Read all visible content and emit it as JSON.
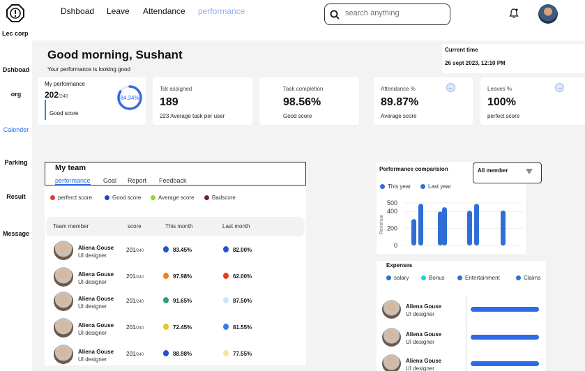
{
  "brand": "Lec corp",
  "sidebar": {
    "items": [
      {
        "label": "Dshboad",
        "active": false
      },
      {
        "label": "org",
        "active": false
      },
      {
        "label": "Calender",
        "active": true
      },
      {
        "label": "Parking",
        "active": false
      },
      {
        "label": "Result",
        "active": false
      },
      {
        "label": "Message",
        "active": false
      }
    ]
  },
  "nav": {
    "items": [
      {
        "label": "Dshboad",
        "active": false
      },
      {
        "label": "Leave",
        "active": false
      },
      {
        "label": "Attendance",
        "active": false
      },
      {
        "label": "performance",
        "active": true
      }
    ]
  },
  "search": {
    "placeholder": "search anything"
  },
  "greeting": {
    "title": "Good morning, Sushant",
    "subtitle": "Your performance is looking good"
  },
  "current_time": {
    "label": "Current time",
    "value": "26 sept 2023, 12:10 PM"
  },
  "my_performance": {
    "label": "My performance",
    "value": "202",
    "total": "/240",
    "sub": "Good score",
    "percent": "84.34%",
    "percent_value": 84.34
  },
  "cards": [
    {
      "label": "Tsk assigned",
      "value": "189",
      "sub": "223 Average task per user",
      "arrow": ""
    },
    {
      "label": "Task completion",
      "value": "98.56%",
      "sub": "Good score",
      "arrow": ""
    },
    {
      "label": "Attendance %",
      "value": "89.87%",
      "sub": "Average score",
      "arrow": "left-arrow-icon"
    },
    {
      "label": "Leaves %",
      "value": "100%",
      "sub": "perfect score",
      "arrow": "right-arrow-icon"
    }
  ],
  "team": {
    "title": "My team",
    "tabs": [
      {
        "label": "performance",
        "active": true
      },
      {
        "label": "Goal",
        "active": false
      },
      {
        "label": "Report",
        "active": false
      },
      {
        "label": "Feedback",
        "active": false
      }
    ],
    "legend": [
      {
        "label": "perferct score",
        "color": "#e53935"
      },
      {
        "label": "Good score",
        "color": "#1e3fd6"
      },
      {
        "label": "Average score",
        "color": "#8bd62b"
      },
      {
        "label": "Badscore",
        "color": "#7a2020"
      }
    ],
    "columns": [
      "Team member",
      "score",
      "This month",
      "Last month"
    ],
    "rows": [
      {
        "name": "Aliena Gouse",
        "role": "UI designer",
        "score": "201",
        "total": "/240",
        "this_month": "83.45%",
        "this_color": "#2354c9",
        "last_month": "82.00%",
        "last_color": "#2354c9"
      },
      {
        "name": "Aliena Gouse",
        "role": "UI designer",
        "score": "201",
        "total": "/240",
        "this_month": "97.98%",
        "this_color": "#ef7d22",
        "last_month": "62.00%",
        "last_color": "#e53b1f"
      },
      {
        "name": "Aliena Gouse",
        "role": "UI designer",
        "score": "201",
        "total": "/240",
        "this_month": "91.65%",
        "this_color": "#2f9e73",
        "last_month": "87.50%",
        "last_color": "#cfe3fb"
      },
      {
        "name": "Aliena Gouse",
        "role": "UI designer",
        "score": "201",
        "total": "/240",
        "this_month": "72.45%",
        "this_color": "#e6c42b",
        "last_month": "81.55%",
        "last_color": "#3b7be0"
      },
      {
        "name": "Aliena Gouse",
        "role": "UI designer",
        "score": "201",
        "total": "/240",
        "this_month": "88.98%",
        "this_color": "#2354c9",
        "last_month": "77.55%",
        "last_color": "#f7e59a"
      }
    ]
  },
  "performance_chart": {
    "title": "Performance comparision",
    "filter": "All member",
    "legend": [
      {
        "label": "This year",
        "color": "#2f6fd4"
      },
      {
        "label": "Last year",
        "color": "#2f6fd4"
      }
    ]
  },
  "chart_data": {
    "type": "bar",
    "title": "Performance comparision",
    "xlabel": "",
    "ylabel": "Revenue",
    "yticks": [
      "500",
      "400",
      "200",
      "0"
    ],
    "ylim": [
      0,
      500
    ],
    "series": [
      {
        "name": "This year",
        "values": [
          310,
          400,
          410,
          410
        ]
      },
      {
        "name": "Last year",
        "values": [
          490,
          450,
          490,
          410
        ]
      }
    ]
  },
  "expenses": {
    "title": "Expenses",
    "legend": [
      {
        "label": "salary",
        "color": "#2f6fd4"
      },
      {
        "label": "Bonus",
        "color": "#19d6dc"
      },
      {
        "label": "Entertainment",
        "color": "#2f6fd4"
      },
      {
        "label": "Claims",
        "color": "#2f6fd4"
      }
    ],
    "rows": [
      {
        "name": "Aliena Gouse",
        "role": "UI designer",
        "amount_fraction": 1.0
      },
      {
        "name": "Aliena Gouse",
        "role": "UI designer",
        "amount_fraction": 1.0
      },
      {
        "name": "Aliena Gouse",
        "role": "UI designer",
        "amount_fraction": 1.0
      }
    ]
  }
}
